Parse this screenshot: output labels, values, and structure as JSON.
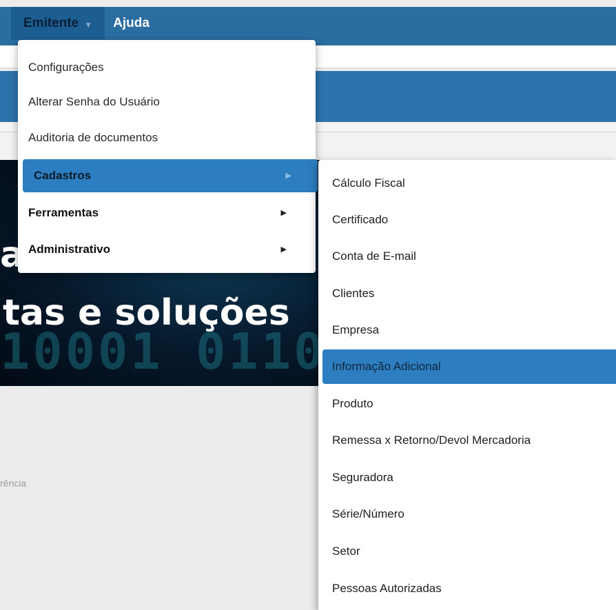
{
  "nav": {
    "emitente_label": "Emitente",
    "ajuda_label": "Ajuda"
  },
  "dropdown": {
    "items": [
      {
        "label": "Configurações"
      },
      {
        "label": "Alterar Senha do Usuário"
      },
      {
        "label": "Auditoria de documentos"
      },
      {
        "label": "Cadastros"
      },
      {
        "label": "Ferramentas"
      },
      {
        "label": "Administrativo"
      }
    ]
  },
  "submenu": {
    "items": [
      {
        "label": "Cálculo Fiscal"
      },
      {
        "label": "Certificado"
      },
      {
        "label": "Conta de E-mail"
      },
      {
        "label": "Clientes"
      },
      {
        "label": "Empresa"
      },
      {
        "label": "Informação Adicional"
      },
      {
        "label": "Produto"
      },
      {
        "label": "Remessa x Retorno/Devol Mercadoria"
      },
      {
        "label": "Seguradora"
      },
      {
        "label": "Série/Número"
      },
      {
        "label": "Setor"
      },
      {
        "label": "Pessoas Autorizadas"
      }
    ]
  },
  "banner": {
    "partial_letter": "a",
    "slogan": "tas e soluções",
    "digits": "10001 0110"
  },
  "page": {
    "fragment_text": "rência"
  },
  "colors": {
    "nav_bar": "#2a6da1",
    "highlight": "#2d7ec0"
  }
}
